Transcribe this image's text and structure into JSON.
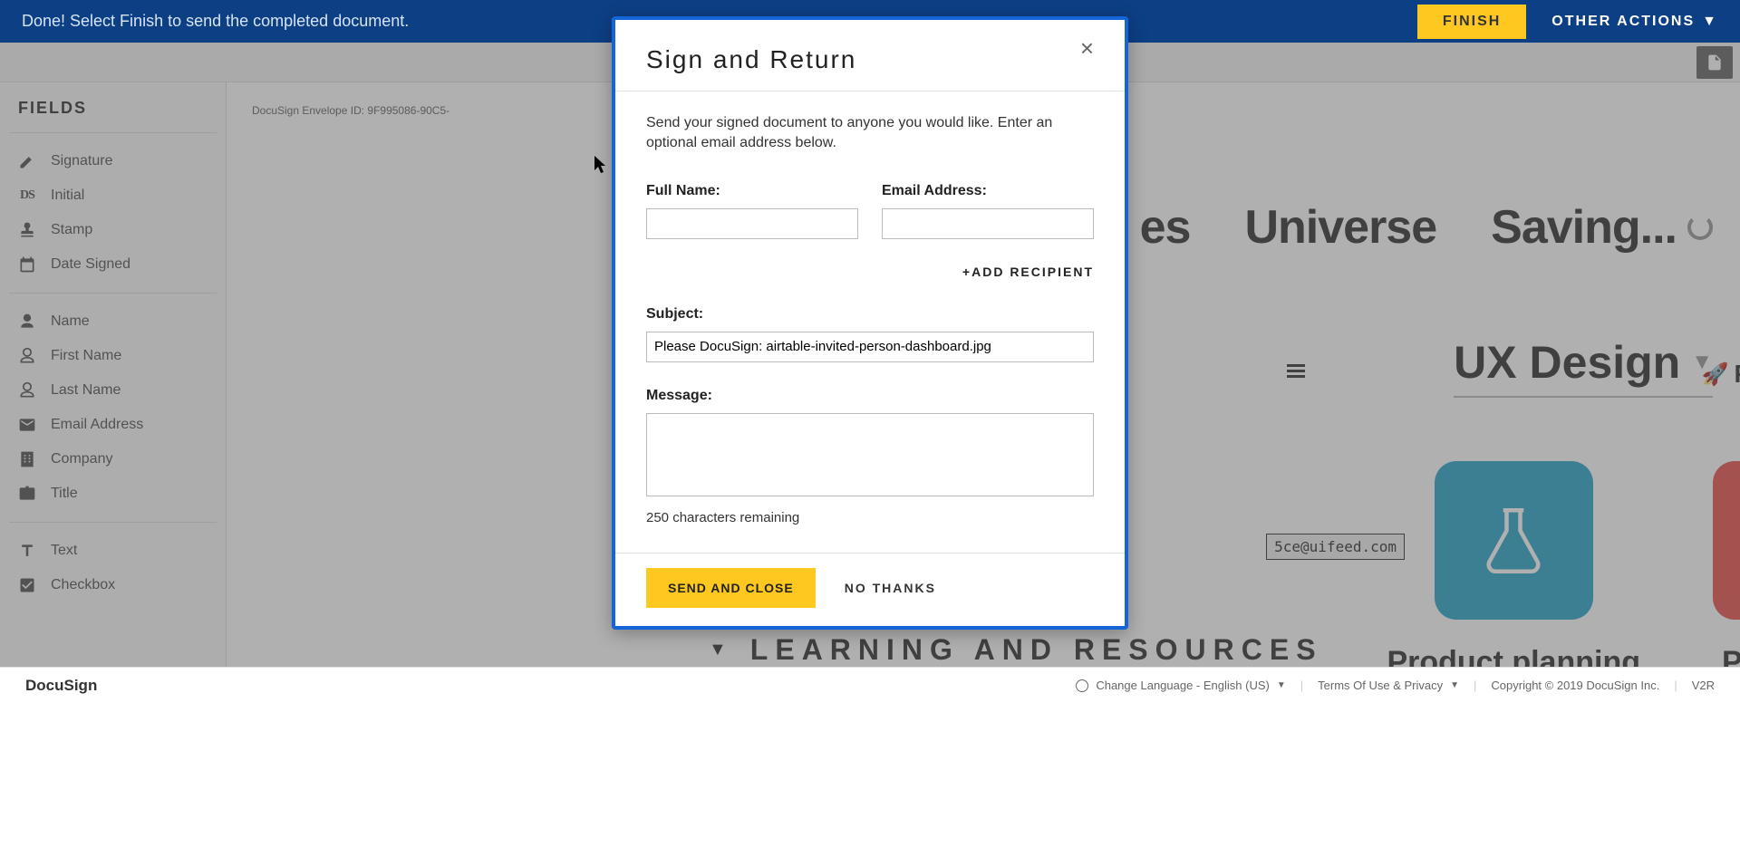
{
  "topbar": {
    "status_text": "Done! Select Finish to send the completed document.",
    "finish_label": "FINISH",
    "other_actions_label": "OTHER ACTIONS"
  },
  "sidebar": {
    "heading": "FIELDS",
    "group1": [
      {
        "icon": "pen",
        "label": "Signature"
      },
      {
        "icon": "ds",
        "label": "Initial"
      },
      {
        "icon": "stamp",
        "label": "Stamp"
      },
      {
        "icon": "calendar",
        "label": "Date Signed"
      }
    ],
    "group2": [
      {
        "icon": "person",
        "label": "Name"
      },
      {
        "icon": "person-outline",
        "label": "First Name"
      },
      {
        "icon": "person-outline",
        "label": "Last Name"
      },
      {
        "icon": "mail",
        "label": "Email Address"
      },
      {
        "icon": "building",
        "label": "Company"
      },
      {
        "icon": "briefcase",
        "label": "Title"
      }
    ],
    "group3": [
      {
        "icon": "text",
        "label": "Text"
      },
      {
        "icon": "checkbox",
        "label": "Checkbox"
      }
    ]
  },
  "doc": {
    "envelope_id_prefix": "DocuSign Envelope ID: 9F995086-90C5-",
    "bg_word_es": "es",
    "bg_word_universe": "Universe",
    "bg_saving": "Saving...",
    "ux_design": "UX Design",
    "email_snippet": "5ce@uifeed.com",
    "product_planning": "Product planning",
    "pi_label": "Pi",
    "pr_label": "Pr",
    "learning_heading": "LEARNING AND RESOURCES"
  },
  "modal": {
    "title": "Sign and Return",
    "description": "Send your signed document to anyone you would like. Enter an optional email address below.",
    "full_name_label": "Full Name:",
    "email_label": "Email Address:",
    "full_name_value": "",
    "email_value": "",
    "add_recipient_label": "+ADD RECIPIENT",
    "subject_label": "Subject:",
    "subject_value": "Please DocuSign: airtable-invited-person-dashboard.jpg",
    "message_label": "Message:",
    "message_value": "",
    "chars_remaining": "250 characters remaining",
    "send_label": "SEND AND CLOSE",
    "nothanks_label": "NO THANKS"
  },
  "footer": {
    "brand": "DocuSign",
    "change_lang": "Change Language - English (US)",
    "terms": "Terms Of Use & Privacy",
    "copyright": "Copyright © 2019 DocuSign Inc.",
    "v2r": "V2R"
  }
}
